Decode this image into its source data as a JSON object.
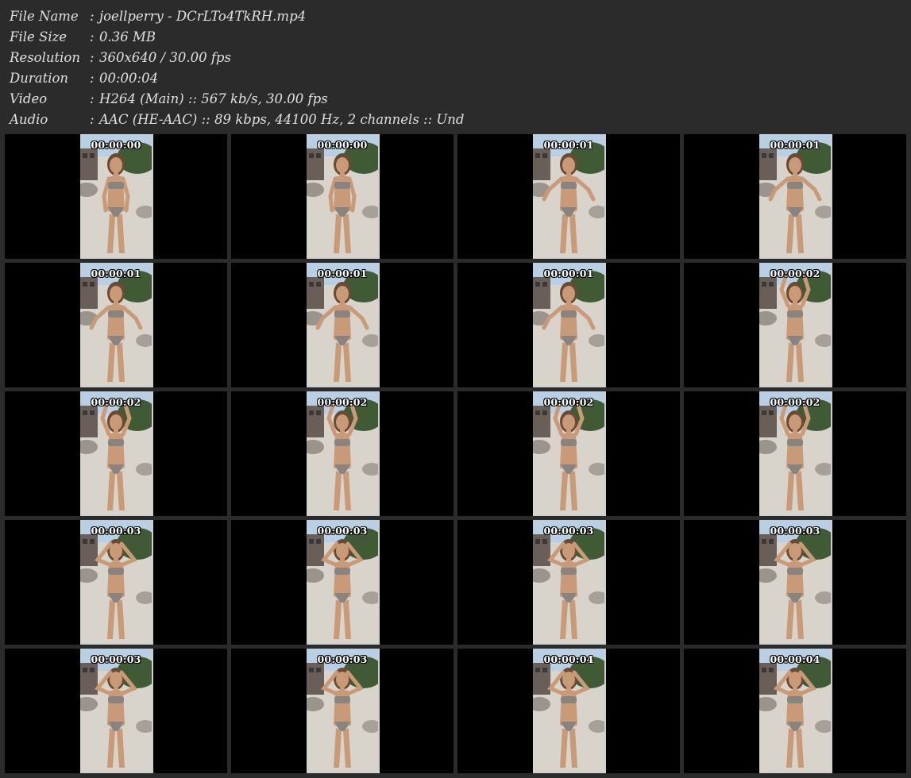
{
  "info": [
    {
      "label": "File Name",
      "value": "joellperry - DCrLTo4TkRH.mp4"
    },
    {
      "label": "File Size",
      "value": "0.36 MB"
    },
    {
      "label": "Resolution",
      "value": "360x640 / 30.00 fps"
    },
    {
      "label": "Duration",
      "value": "00:00:04"
    },
    {
      "label": "Video",
      "value": "H264 (Main) :: 567 kb/s, 30.00 fps"
    },
    {
      "label": "Audio",
      "value": "AAC (HE-AAC) :: 89 kbps, 44100 Hz, 2 channels :: Und"
    }
  ],
  "separator": ":",
  "thumbnails": [
    {
      "timestamp": "00:00:00",
      "pose": "arms-down"
    },
    {
      "timestamp": "00:00:00",
      "pose": "arms-down"
    },
    {
      "timestamp": "00:00:01",
      "pose": "arms-out"
    },
    {
      "timestamp": "00:00:01",
      "pose": "arms-out"
    },
    {
      "timestamp": "00:00:01",
      "pose": "arms-out"
    },
    {
      "timestamp": "00:00:01",
      "pose": "arms-out"
    },
    {
      "timestamp": "00:00:01",
      "pose": "arms-out"
    },
    {
      "timestamp": "00:00:02",
      "pose": "arms-up"
    },
    {
      "timestamp": "00:00:02",
      "pose": "arms-up"
    },
    {
      "timestamp": "00:00:02",
      "pose": "arms-up"
    },
    {
      "timestamp": "00:00:02",
      "pose": "arms-up"
    },
    {
      "timestamp": "00:00:02",
      "pose": "arms-up"
    },
    {
      "timestamp": "00:00:03",
      "pose": "hands-on-head"
    },
    {
      "timestamp": "00:00:03",
      "pose": "hands-on-head"
    },
    {
      "timestamp": "00:00:03",
      "pose": "hands-on-head"
    },
    {
      "timestamp": "00:00:03",
      "pose": "hands-on-head"
    },
    {
      "timestamp": "00:00:03",
      "pose": "hands-on-head"
    },
    {
      "timestamp": "00:00:03",
      "pose": "hands-on-head"
    },
    {
      "timestamp": "00:00:04",
      "pose": "hands-on-head"
    },
    {
      "timestamp": "00:00:04",
      "pose": "hands-on-head"
    }
  ],
  "colors": {
    "background": "#2b2b2b",
    "cell": "#000000",
    "text": "#e0e0e0",
    "sky": "#b9cfe4",
    "foliage": "#3f5a34",
    "sand": "#d8d4cc",
    "skin": "#c99a78",
    "hair": "#6b4a32",
    "suit": "#8a8480"
  }
}
